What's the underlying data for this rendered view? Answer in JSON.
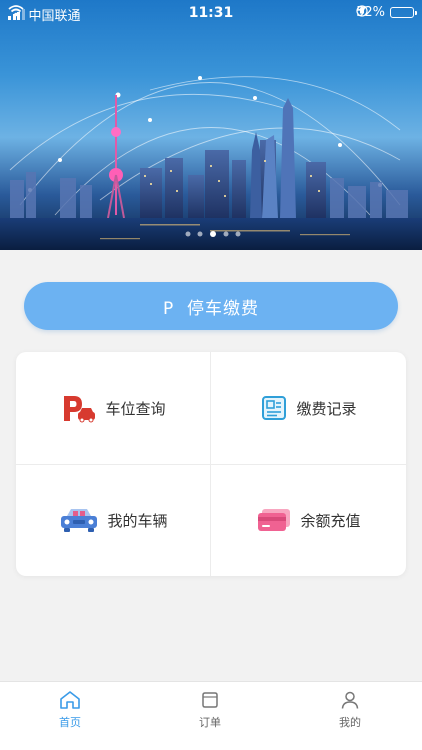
{
  "status_bar": {
    "carrier": "中国联通",
    "time": "11:31",
    "battery": "52%",
    "battery_level": 0.52
  },
  "main_button": {
    "label": "P  停车缴费"
  },
  "grid": [
    {
      "label": "车位查询",
      "icon": "parking-car-icon",
      "color": "#d73a2f"
    },
    {
      "label": "缴费记录",
      "icon": "receipt-icon",
      "color": "#2f9fd8"
    },
    {
      "label": "我的车辆",
      "icon": "vehicle-icon",
      "color": "#4a7fd6"
    },
    {
      "label": "余额充值",
      "icon": "card-icon",
      "color": "#f06292"
    }
  ],
  "tabbar": [
    {
      "label": "首页",
      "icon": "home-icon",
      "active": true
    },
    {
      "label": "订单",
      "icon": "order-icon",
      "active": false
    },
    {
      "label": "我的",
      "icon": "profile-icon",
      "active": false
    }
  ],
  "colors": {
    "accent": "#3a9be8",
    "button": "#6cb2f2"
  }
}
